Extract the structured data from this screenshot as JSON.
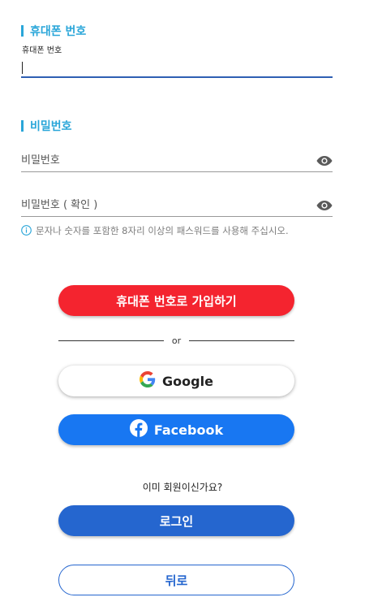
{
  "phone_section": {
    "title": "휴대폰 번호",
    "field_label": "휴대폰 번호",
    "value": ""
  },
  "password_section": {
    "title": "비밀번호",
    "password_placeholder": "비밀번호",
    "confirm_placeholder": "비밀번호 ( 확인 )",
    "hint": "문자나 숫자를 포함한 8자리 이상의 패스워드를 사용해 주십시오."
  },
  "buttons": {
    "signup": "휴대폰 번호로 가입하기",
    "divider": "or",
    "google": "Google",
    "facebook": "Facebook",
    "login": "로그인",
    "back": "뒤로"
  },
  "already_member": "이미 회원이신가요?",
  "icons": {
    "eye": "eye-icon",
    "info": "info-circle-icon",
    "google": "google-logo-icon",
    "facebook": "facebook-logo-icon"
  },
  "colors": {
    "accent": "#2aa6d9",
    "signup": "#f4242f",
    "facebook": "#1877f2",
    "login": "#2566cf"
  }
}
